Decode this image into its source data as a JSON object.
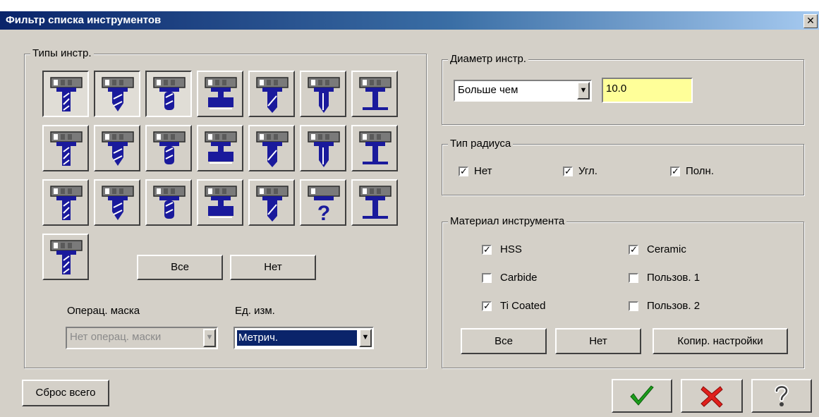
{
  "window": {
    "title": "Фильтр списка инструментов",
    "close_glyph": "✕"
  },
  "tool_types": {
    "legend": "Типы инстр.",
    "icons": [
      "flat-end-mill",
      "ball-end-mill",
      "bull-nose-mill",
      "slot-mill",
      "drill",
      "center-drill",
      "face-mill",
      "chamfer-mill",
      "dovetail-mill",
      "lollipop-mill",
      "reamer",
      "boring-bar",
      "counterbore",
      "tap",
      "thread-mill",
      "keyseat-cutter",
      "spot-drill",
      "step-drill",
      "engrave-tool",
      "unknown-tool",
      "countersink",
      "spiral-drill"
    ],
    "all_label": "Все",
    "none_label": "Нет",
    "op_mask_label": "Операц. маска",
    "op_mask_value": "Нет операц. маски",
    "units_label": "Ед. изм.",
    "units_value": "Метрич."
  },
  "diameter": {
    "legend": "Диаметр инстр.",
    "compare_value": "Больше чем",
    "value": "10.0"
  },
  "radius_type": {
    "legend": "Тип радиуса",
    "options": [
      {
        "label": "Нет",
        "checked": true
      },
      {
        "label": "Угл.",
        "checked": true
      },
      {
        "label": "Полн.",
        "checked": true
      }
    ]
  },
  "material": {
    "legend": "Материал инструмента",
    "options": [
      {
        "label": "HSS",
        "checked": true
      },
      {
        "label": "Ceramic",
        "checked": true
      },
      {
        "label": "Carbide",
        "checked": false
      },
      {
        "label": "Пользов. 1",
        "checked": false
      },
      {
        "label": "Ti Coated",
        "checked": true
      },
      {
        "label": "Пользов. 2",
        "checked": false
      }
    ],
    "all_label": "Все",
    "none_label": "Нет",
    "copy_label": "Копир. настройки"
  },
  "footer": {
    "reset_label": "Сброс всего",
    "ok_icon": "checkmark-icon",
    "cancel_icon": "x-icon",
    "help_icon": "question-icon",
    "ok_color": "#1c9e1c",
    "cancel_color": "#e0201c"
  }
}
